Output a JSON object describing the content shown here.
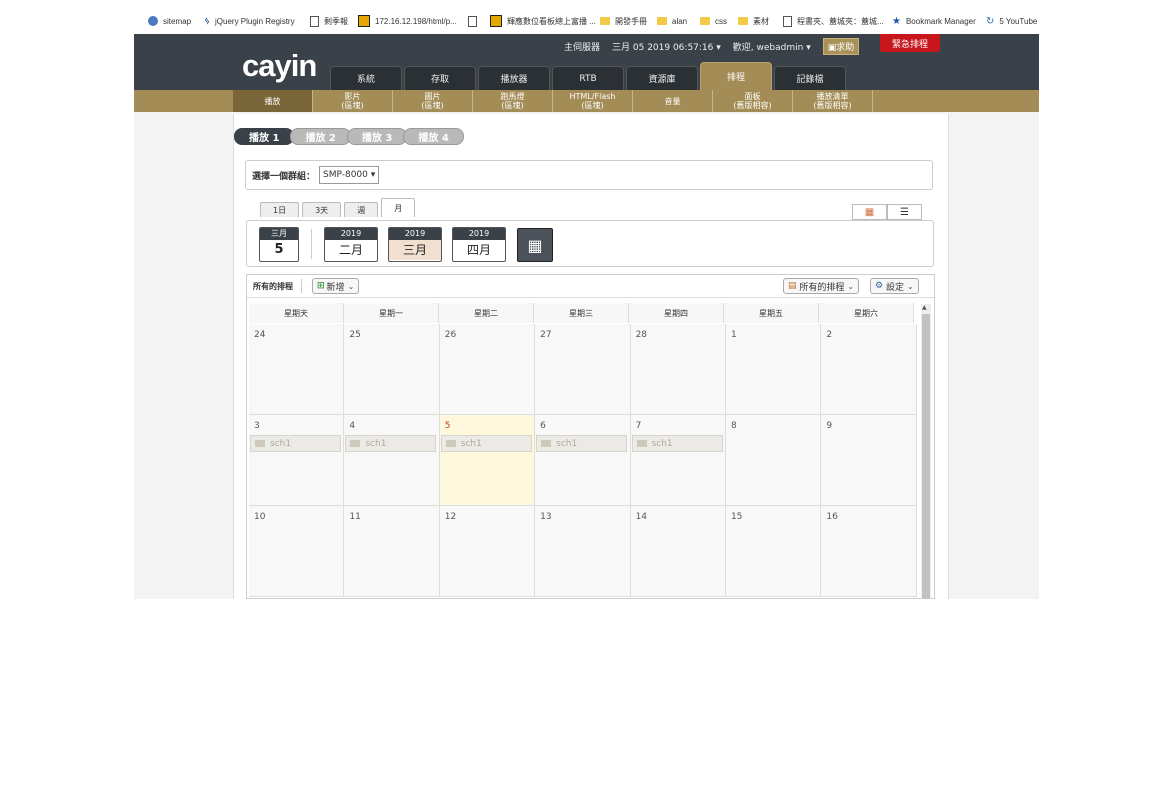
{
  "bookmarks": [
    {
      "label": "sitemap",
      "icon": "globe-icon"
    },
    {
      "label": "jQuery Plugin Registry",
      "icon": "jquery-icon"
    },
    {
      "label": "剩季報",
      "icon": "page-icon"
    },
    {
      "label": "172.16.12.198/html/p...",
      "icon": "cayin-icon"
    },
    {
      "label": "",
      "icon": "page-icon"
    },
    {
      "label": "輝應數位看板總上富播 ...",
      "icon": "cayin-icon"
    },
    {
      "label": "開發手冊",
      "icon": "folder-icon"
    },
    {
      "label": "alan",
      "icon": "folder-icon"
    },
    {
      "label": "css",
      "icon": "folder-icon"
    },
    {
      "label": "素材",
      "icon": "folder-icon"
    },
    {
      "label": "程書夾、蓋城夾：蓋城...",
      "icon": "page-icon"
    },
    {
      "label": "Bookmark Manager",
      "icon": "star-icon"
    },
    {
      "label": "5 YouTube",
      "icon": "youtube-icon"
    }
  ],
  "header": {
    "logo": "cayin",
    "server_label": "主伺服器",
    "datetime": "三月 05 2019 06:57:16",
    "welcome": "歡迎, webadmin",
    "help": "求助",
    "emergency": "緊急排程"
  },
  "nav_tabs": [
    "系統",
    "存取",
    "播放器",
    "RTB",
    "資源庫",
    "排程",
    "記錄檔"
  ],
  "nav_active": "排程",
  "subnav": [
    "播放",
    "影片\n(區塊)",
    "圖片\n(區塊)",
    "跑馬燈\n(區塊)",
    "HTML/Flash\n(區塊)",
    "音量",
    "面板\n(舊版相容)",
    "播放清單\n(舊版相容)"
  ],
  "play_tabs": [
    "播放 1",
    "播放 2",
    "播放 3",
    "播放 4"
  ],
  "group": {
    "label": "選擇一個群組：",
    "value": "SMP-8000"
  },
  "view_tabs": [
    "1日",
    "3天",
    "週",
    "月"
  ],
  "date_bar": {
    "today": {
      "month": "三月",
      "day": "5"
    },
    "months": [
      {
        "year": "2019",
        "month": "二月",
        "current": false
      },
      {
        "year": "2019",
        "month": "三月",
        "current": true
      },
      {
        "year": "2019",
        "month": "四月",
        "current": false
      }
    ]
  },
  "panel": {
    "title": "所有的排程",
    "add": "新增",
    "filter": "所有的排程",
    "settings": "設定"
  },
  "weekdays": [
    "星期天",
    "星期一",
    "星期二",
    "星期三",
    "星期四",
    "星期五",
    "星期六"
  ],
  "weeks": [
    [
      {
        "d": "24"
      },
      {
        "d": "25"
      },
      {
        "d": "26"
      },
      {
        "d": "27"
      },
      {
        "d": "28"
      },
      {
        "d": "1"
      },
      {
        "d": "2"
      }
    ],
    [
      {
        "d": "3",
        "ev": "sch1"
      },
      {
        "d": "4",
        "ev": "sch1"
      },
      {
        "d": "5",
        "ev": "sch1",
        "today": true
      },
      {
        "d": "6",
        "ev": "sch1"
      },
      {
        "d": "7",
        "ev": "sch1"
      },
      {
        "d": "8"
      },
      {
        "d": "9"
      }
    ],
    [
      {
        "d": "10"
      },
      {
        "d": "11"
      },
      {
        "d": "12"
      },
      {
        "d": "13"
      },
      {
        "d": "14"
      },
      {
        "d": "15"
      },
      {
        "d": "16"
      }
    ]
  ]
}
